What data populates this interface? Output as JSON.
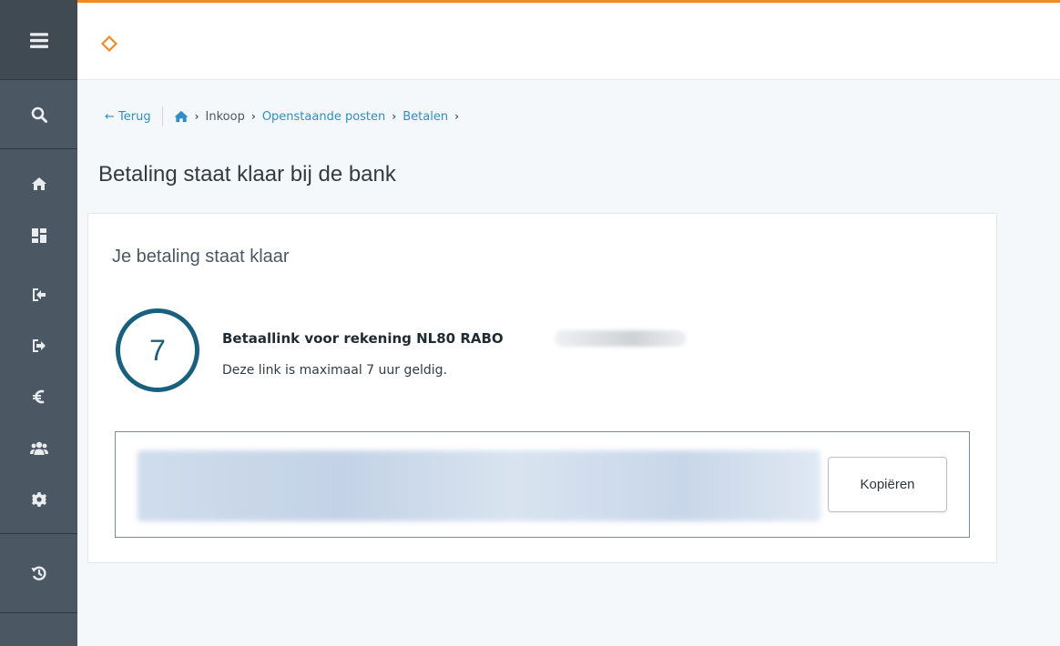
{
  "sidebar": {
    "items": [
      {
        "icon": "menu-icon"
      },
      {
        "icon": "search-icon"
      },
      {
        "icon": "home-icon"
      },
      {
        "icon": "dashboard-icon"
      },
      {
        "icon": "sign-in-icon"
      },
      {
        "icon": "sign-out-icon"
      },
      {
        "icon": "euro-icon"
      },
      {
        "icon": "users-icon"
      },
      {
        "icon": "gear-icon"
      },
      {
        "icon": "history-icon"
      }
    ]
  },
  "colors": {
    "accent": "#f08a1e",
    "link": "#2f8fc4",
    "sidebar": "#4b5863",
    "counter": "#17617f"
  },
  "breadcrumb": {
    "back": "← Terug",
    "items": [
      "Inkoop",
      "Openstaande posten",
      "Betalen"
    ]
  },
  "page": {
    "title": "Betaling staat klaar bij de bank"
  },
  "card": {
    "title": "Je betaling staat klaar",
    "counter": "7",
    "link_title": "Betaallink voor rekening NL80 RABO",
    "link_subtitle": "Deze link is maximaal 7 uur geldig.",
    "copy_label": "Kopiëren"
  }
}
